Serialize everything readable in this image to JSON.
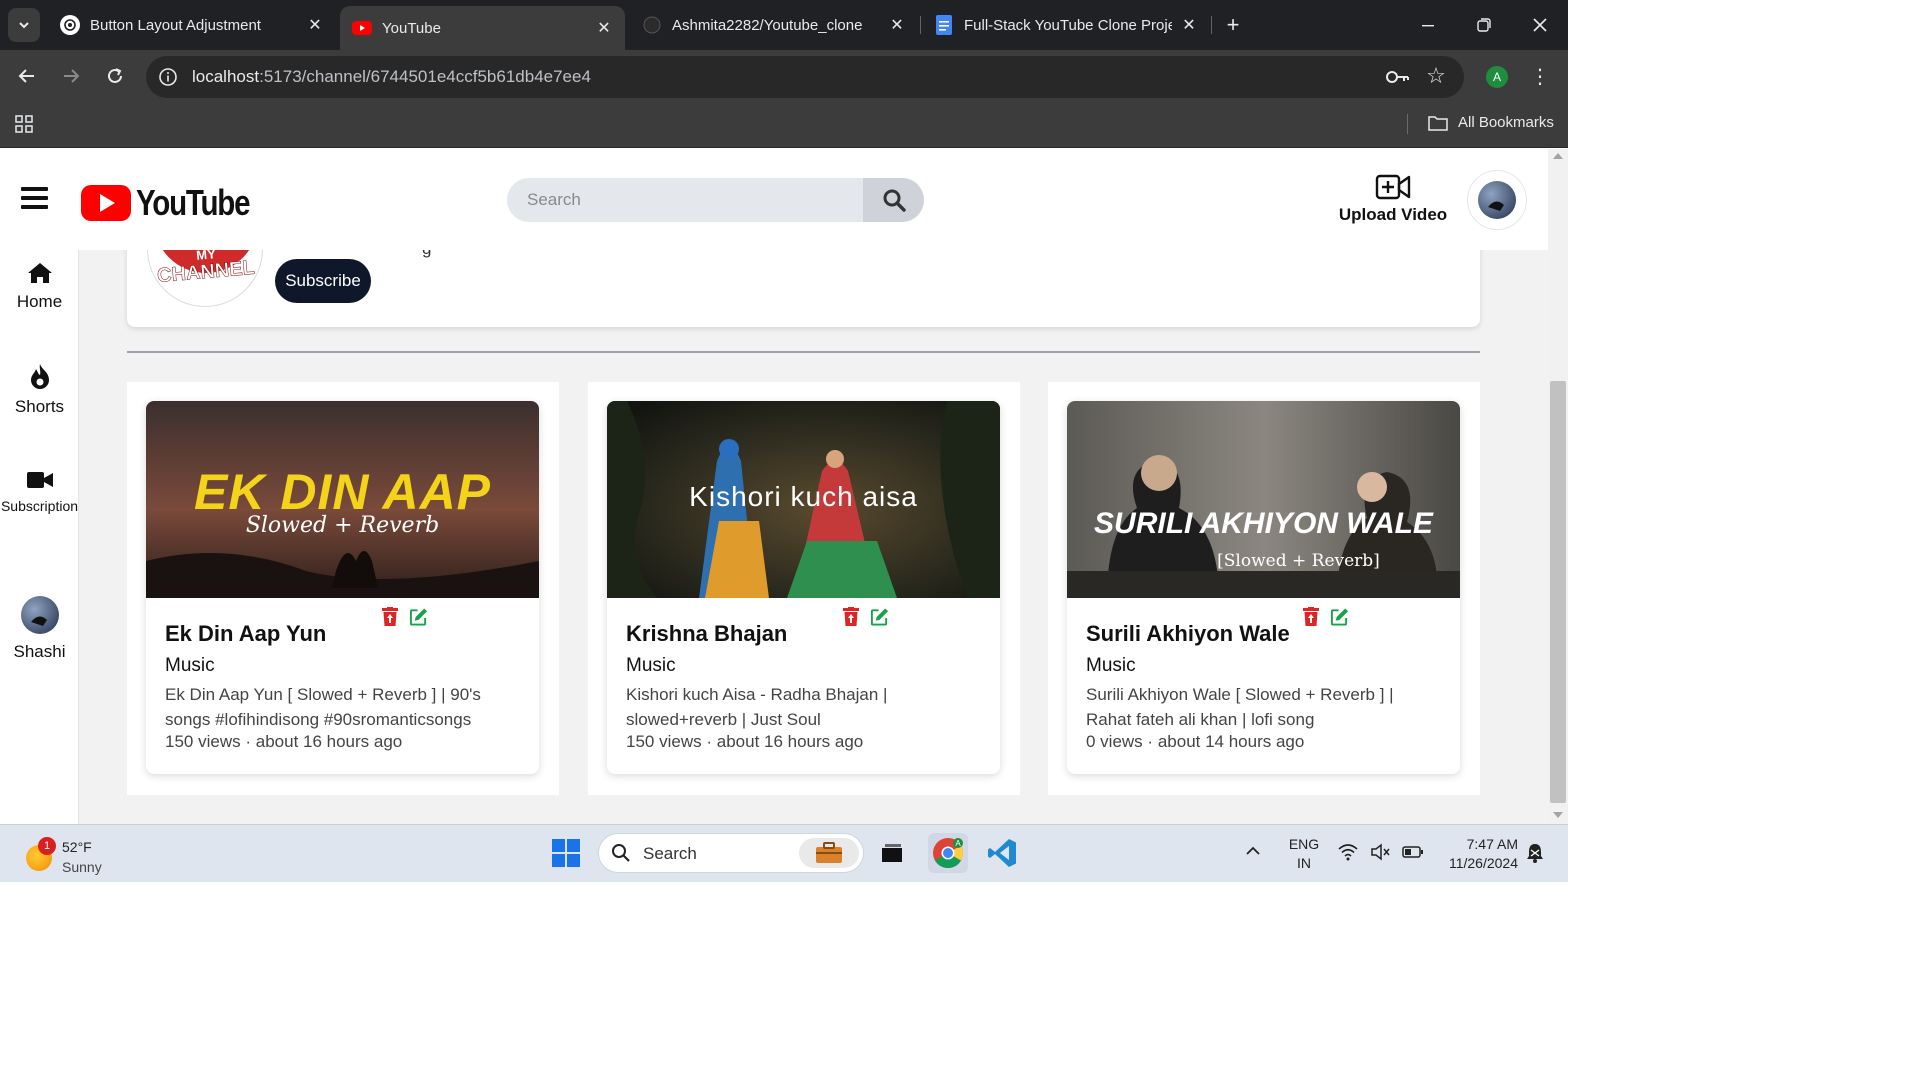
{
  "browser": {
    "tabs": [
      {
        "title": "Button Layout Adjustment",
        "active": false
      },
      {
        "title": "YouTube",
        "active": true
      },
      {
        "title": "Ashmita2282/Youtube_clone",
        "active": false
      },
      {
        "title": "Full-Stack YouTube Clone Proje",
        "active": false
      }
    ],
    "url_host": "localhost",
    "url_path": ":5173/channel/6744501e4ccf5b61db4e7ee4",
    "profile_initial": "A",
    "bookmarks_label": "All Bookmarks"
  },
  "header": {
    "logo_text": "YouTube",
    "search_placeholder": "Search",
    "upload_label": "Upload Video"
  },
  "sidebar": {
    "items": [
      {
        "label": "Home",
        "icon": "home-icon"
      },
      {
        "label": "Shorts",
        "icon": "flame-icon"
      },
      {
        "label": "Subscription",
        "icon": "video-camera-icon"
      },
      {
        "label": "Shashi",
        "icon": "avatar"
      }
    ]
  },
  "channel": {
    "logo_text_top": "MY",
    "logo_text": "CHANNEL",
    "peek_text": "g",
    "subscribe_label": "Subscribe"
  },
  "videos": [
    {
      "thumb_title": "EK DIN AAP",
      "thumb_subtitle": "Slowed + Reverb",
      "title": "Ek Din Aap Yun",
      "category": "Music",
      "description": "Ek Din Aap Yun [ Slowed + Reverb ] | 90's songs #lofihindisong #90sromanticsongs",
      "views": "150 views",
      "time": "about 16 hours ago"
    },
    {
      "thumb_title": "Kishori kuch aisa",
      "thumb_subtitle": "",
      "title": "Krishna Bhajan",
      "category": "Music",
      "description": "Kishori kuch Aisa - Radha Bhajan | slowed+reverb | Just Soul",
      "views": "150 views",
      "time": "about 16 hours ago"
    },
    {
      "thumb_title": "SURILI AKHIYON WALE",
      "thumb_subtitle": "[Slowed + Reverb]",
      "title": "Surili Akhiyon Wale",
      "category": "Music",
      "description": "Surili Akhiyon Wale [ Slowed + Reverb ] | Rahat fateh ali khan | lofi song",
      "views": "0 views",
      "time": "about 14 hours ago"
    }
  ],
  "meta_separator": "·",
  "taskbar": {
    "weather_badge": "1",
    "temperature": "52°F",
    "condition": "Sunny",
    "search_label": "Search",
    "lang_top": "ENG",
    "lang_bottom": "IN",
    "time": "7:47 AM",
    "date": "11/26/2024"
  },
  "colors": {
    "youtube_red": "#ff0000",
    "delete_red": "#dc2626",
    "edit_green": "#16a34a",
    "subscribe_bg": "#0f172a"
  }
}
